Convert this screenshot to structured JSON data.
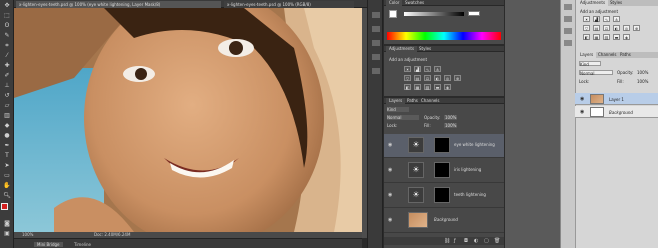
{
  "document_tabs": [
    {
      "label": "x-lighten-eyes-teeth.psd @ 100% (eye white lightening, Layer Mask/8)",
      "active": true
    },
    {
      "label": "x-lighten-eyes-teeth.psd @ 100% (RGB/8)",
      "active": false
    }
  ],
  "status": {
    "zoom": "100%",
    "doc": "Doc: 2.40M/6.24M"
  },
  "mini_bridge": {
    "tabs": [
      "Mini Bridge",
      "Timeline"
    ]
  },
  "color_panel": {
    "tabs": [
      "Color",
      "Swatches"
    ]
  },
  "adjustments_panel": {
    "tabs": [
      "Adjustments",
      "Styles"
    ],
    "title": "Add an adjustment"
  },
  "layers_panel": {
    "tabs": [
      "Layers",
      "Paths",
      "Channels"
    ],
    "kind_label": "Kind",
    "blend_mode": "Normal",
    "opacity_label": "Opacity:",
    "opacity_value": "100%",
    "lock_label": "Lock:",
    "fill_label": "Fill:",
    "fill_value": "100%",
    "layers": [
      {
        "name": "eye white lightening",
        "selected": true
      },
      {
        "name": "iris lightening",
        "selected": false
      },
      {
        "name": "teeth lightening",
        "selected": false
      },
      {
        "name": "Background",
        "selected": false
      }
    ]
  },
  "right_adjustments": {
    "tabs": [
      "Adjustments",
      "Styles"
    ],
    "title": "Add an adjustment"
  },
  "right_layers": {
    "tabs": [
      "Layers",
      "Channels",
      "Paths"
    ],
    "kind_label": "Kind",
    "blend_mode": "Normal",
    "opacity_label": "Opacity:",
    "opacity_value": "100%",
    "lock_label": "Lock:",
    "fill_label": "Fill:",
    "fill_value": "100%",
    "layers": [
      {
        "name": "Layer 1",
        "selected": true
      },
      {
        "name": "Background",
        "selected": false
      }
    ]
  },
  "colors": {
    "accent": "#2f5fa8",
    "foreground": "#d21f1f",
    "selection_dark": "#5a5f6a",
    "selection_light": "#b8cde8"
  }
}
